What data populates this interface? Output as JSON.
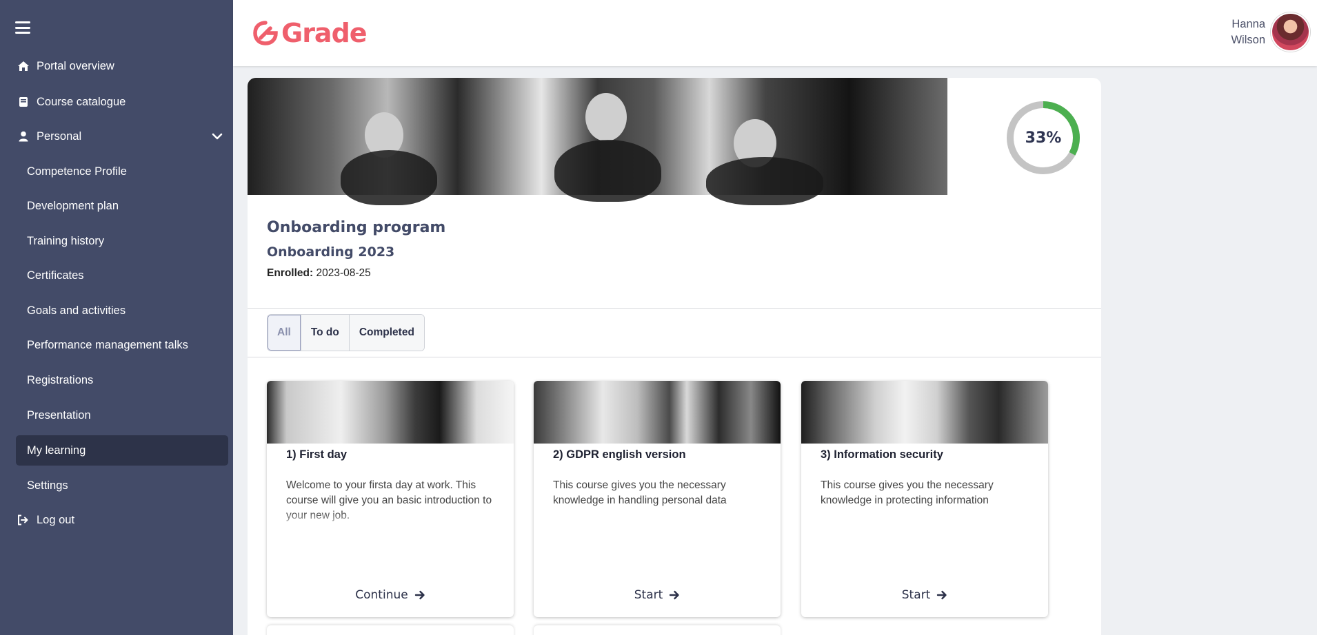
{
  "brand": {
    "name": "Grade",
    "color": "#ef5f6c"
  },
  "user": {
    "first_name": "Hanna",
    "last_name": "Wilson"
  },
  "sidebar": {
    "items": [
      {
        "label": "Portal overview",
        "icon": "home-icon"
      },
      {
        "label": "Course catalogue",
        "icon": "book-icon"
      },
      {
        "label": "Personal",
        "icon": "user-icon",
        "expanded": true
      },
      {
        "label": "Competence Profile"
      },
      {
        "label": "Development plan"
      },
      {
        "label": "Training history"
      },
      {
        "label": "Certificates"
      },
      {
        "label": "Goals and activities"
      },
      {
        "label": "Performance management talks"
      },
      {
        "label": "Registrations"
      },
      {
        "label": "Presentation"
      },
      {
        "label": "My learning",
        "active": true
      },
      {
        "label": "Settings"
      },
      {
        "label": "Log out",
        "icon": "logout-icon"
      }
    ]
  },
  "program": {
    "title": "Onboarding program",
    "subtitle": "Onboarding 2023",
    "enrolled_label": "Enrolled:",
    "enrolled_date": "2023-08-25",
    "progress_text": "33%",
    "progress": 0.33,
    "progress_color": "#4caf50",
    "track_color": "#c4c4c4"
  },
  "tabs": [
    {
      "label": "All",
      "active": true
    },
    {
      "label": "To do"
    },
    {
      "label": "Completed"
    }
  ],
  "courses": [
    {
      "title": "1) First day",
      "description": "Welcome to your firsta day at work. This course will give you an basic introduction to your new job.",
      "action": "Continue"
    },
    {
      "title": "2) GDPR english version",
      "description": "This course gives you the necessary knowledge in handling personal data",
      "action": "Start"
    },
    {
      "title": "3) Information security",
      "description": "This course gives you the necessary knowledge in protecting information",
      "action": "Start"
    }
  ]
}
